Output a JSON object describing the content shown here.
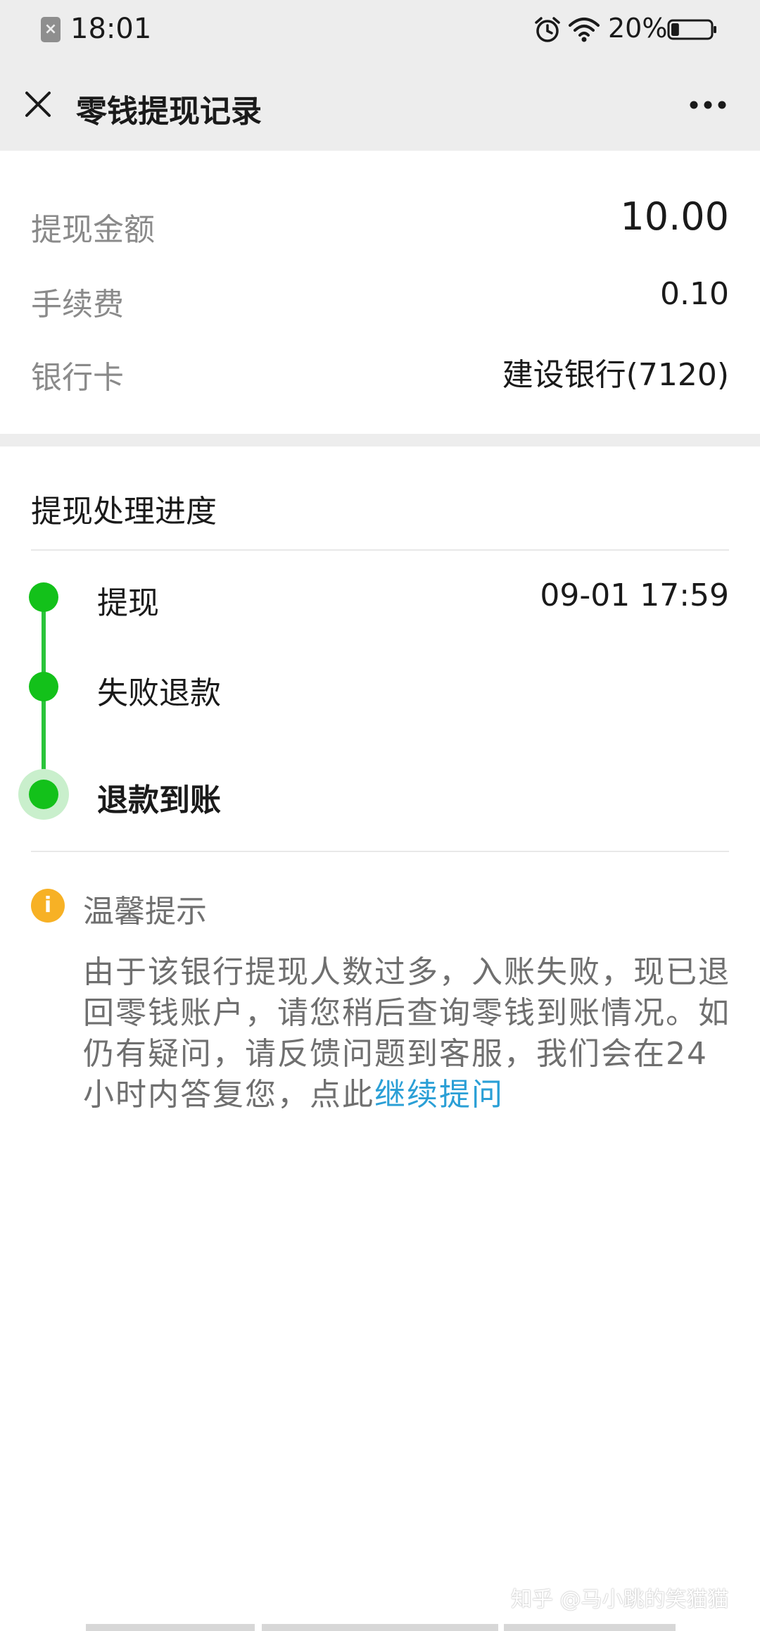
{
  "status_bar": {
    "time": "18:01",
    "battery_percent": "20%",
    "battery_level": 0.2,
    "notification_icon": "notification-blocked-icon",
    "icons": [
      "alarm-icon",
      "wifi-icon",
      "battery-icon"
    ]
  },
  "nav": {
    "title": "零钱提现记录",
    "close_icon": "close-icon",
    "more_icon": "more-icon"
  },
  "summary": {
    "rows": [
      {
        "label": "提现金额",
        "value": "10.00"
      },
      {
        "label": "手续费",
        "value": "0.10"
      },
      {
        "label": "银行卡",
        "value": "建设银行(7120)"
      }
    ]
  },
  "progress": {
    "title": "提现处理进度",
    "steps": [
      {
        "label": "提现",
        "time": "09-01 17:59"
      },
      {
        "label": "失败退款",
        "time": ""
      },
      {
        "label": "退款到账",
        "time": ""
      }
    ],
    "accent_color": "#13c11a"
  },
  "tip": {
    "title": "温馨提示",
    "text": "由于该银行提现人数过多，入账失败，现已退回零钱账户，请您稍后查询零钱到账情况。如仍有疑问，请反馈问题到客服，我们会在24小时内答复您，点此",
    "link": "继续提问",
    "link_color": "#2a9fd6",
    "icon": "info-icon"
  },
  "watermark": "知乎 @马小跳的笑猫猫"
}
